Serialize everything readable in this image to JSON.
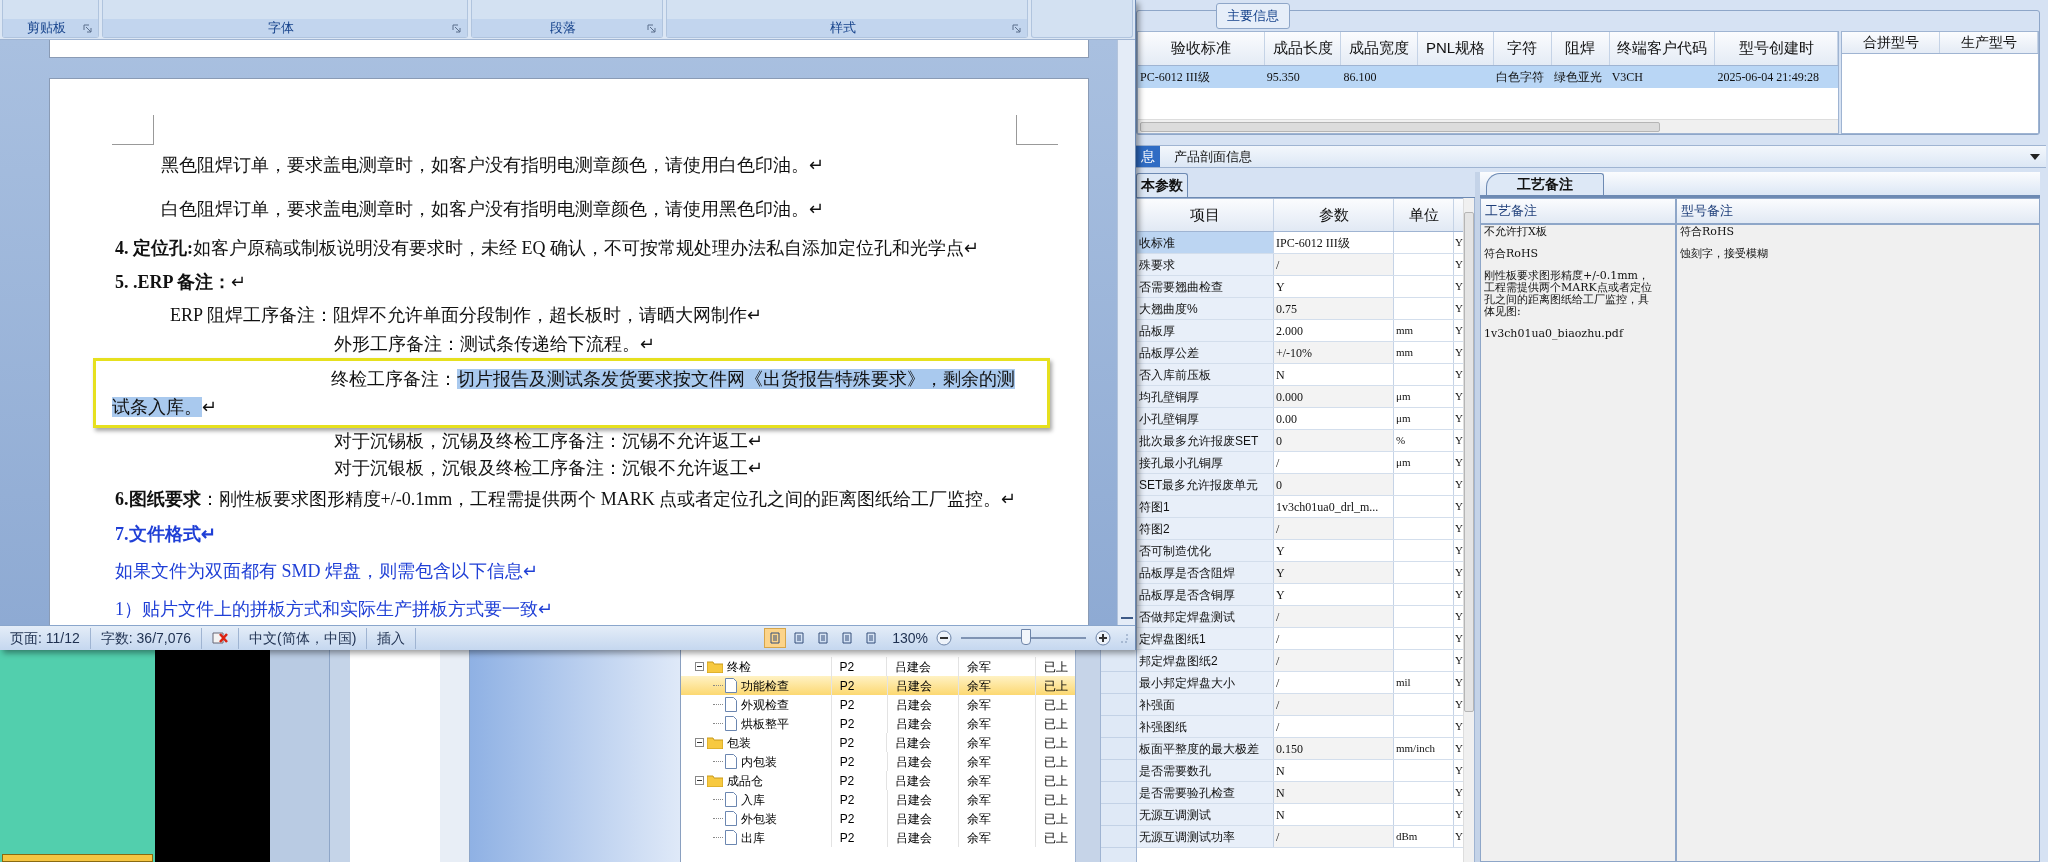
{
  "word": {
    "ribbon_groups": [
      "剪贴板",
      "字体",
      "段落",
      "样式"
    ],
    "paragraphs": [
      {
        "kind": "body",
        "framed": false,
        "text": "黑色阻焊订单，要求盖电测章时，如客户没有指明电测章颜色，请使用白色印油。↵"
      },
      {
        "kind": "body",
        "framed": false,
        "text": "白色阻焊订单，要求盖电测章时，如客户没有指明电测章颜色，请使用黑色印油。↵"
      },
      {
        "kind": "numbered",
        "framed": false,
        "text": "**4.  定位孔:**如客户原稿或制板说明没有要求时，未经 EQ 确认，不可按常规处理办法私自添加定位孔和光学点↵"
      },
      {
        "kind": "numbered",
        "framed": false,
        "text": "**5. .ERP 备注：**↵"
      },
      {
        "kind": "erp",
        "framed": false,
        "text": "ERP 阻焊工序备注：阻焊不允许单面分段制作，超长板时，请晒大网制作↵"
      },
      {
        "kind": "note",
        "framed": false,
        "text": "外形工序备注：测试条传递给下流程。↵"
      },
      {
        "kind": "note_wrap",
        "framed": true,
        "segments": [
          {
            "text": "终检工序备注：",
            "highlighted": false
          },
          {
            "text": "切片报告及测试条发货要求按文件网《出货报告特殊要求》，剩余的测试条入库。",
            "highlighted": true
          },
          {
            "text": "↵",
            "highlighted": false
          }
        ]
      },
      {
        "kind": "note",
        "framed": false,
        "text": "对于沉锡板，沉锡及终检工序备注：沉锡不允许返工↵"
      },
      {
        "kind": "note",
        "framed": false,
        "text": "对于沉银板，沉银及终检工序备注：沉银不允许返工↵"
      },
      {
        "kind": "numbered",
        "framed": false,
        "text": "**6.图纸要求**：刚性板要求图形精度+/-0.1mm，工程需提供两个 MARK 点或者定位孔之间的距离图纸给工厂监控。↵"
      },
      {
        "kind": "blue_heading",
        "framed": false,
        "text": "7.文件格式↵"
      },
      {
        "kind": "blue",
        "framed": false,
        "text": "如果文件为双面都有 SMD 焊盘，则需包含以下信息↵"
      },
      {
        "kind": "blue",
        "framed": false,
        "text": "1）贴片文件上的拼板方式和实际生产拼板方式要一致↵"
      }
    ],
    "status": {
      "page": "页面: 11/12",
      "words": "字数: 36/7,076",
      "language": "中文(简体，中国)",
      "mode": "插入",
      "zoom": "130%",
      "zoom_slider": {
        "level": 0.52
      },
      "view_buttons": [
        {
          "selected": true
        },
        {
          "selected": false
        },
        {
          "selected": false
        },
        {
          "selected": false
        },
        {
          "selected": false
        }
      ]
    }
  },
  "tree": {
    "items": [
      {
        "kind": "folder",
        "label": "终检",
        "expanded": true,
        "selected": false,
        "cells": [
          "P2",
          "吕建会",
          "余军",
          "已上"
        ],
        "children": [
          {
            "kind": "file",
            "label": "功能检查",
            "selected": true,
            "cells": [
              "P2",
              "吕建会",
              "余军",
              "已上"
            ]
          },
          {
            "kind": "file",
            "label": "外观检查",
            "selected": false,
            "cells": [
              "P2",
              "吕建会",
              "余军",
              "已上"
            ]
          },
          {
            "kind": "file",
            "label": "烘板整平",
            "selected": false,
            "cells": [
              "P2",
              "吕建会",
              "余军",
              "已上"
            ]
          }
        ]
      },
      {
        "kind": "folder",
        "label": "包装",
        "expanded": true,
        "selected": false,
        "cells": [
          "P2",
          "吕建会",
          "余军",
          "已上"
        ],
        "children": [
          {
            "kind": "file",
            "label": "内包装",
            "selected": false,
            "cells": [
              "P2",
              "吕建会",
              "余军",
              "已上"
            ]
          }
        ]
      },
      {
        "kind": "folder",
        "label": "成品仓",
        "expanded": true,
        "selected": false,
        "cells": [
          "P2",
          "吕建会",
          "余军",
          "已上"
        ],
        "children": [
          {
            "kind": "file",
            "label": "入库",
            "selected": false,
            "cells": [
              "P2",
              "吕建会",
              "余军",
              "已上"
            ]
          },
          {
            "kind": "file",
            "label": "外包装",
            "selected": false,
            "cells": [
              "P2",
              "吕建会",
              "余军",
              "已上"
            ]
          },
          {
            "kind": "file",
            "label": "出库",
            "selected": false,
            "cells": [
              "P2",
              "吕建会",
              "余军",
              "已上"
            ]
          }
        ]
      }
    ]
  },
  "main_info": {
    "legend": "主要信息",
    "columns": [
      "验收标准",
      "成品长度",
      "成品宽度",
      "PNL规格",
      "字符",
      "阻焊",
      "终端客户代码",
      "型号创建时"
    ],
    "rows": [
      {
        "selected": true,
        "cells": [
          "PC-6012 III级",
          "95.350",
          "86.100",
          null,
          "白色字符",
          "绿色亚光",
          "V3CH",
          "2025-06-04 21:49:28"
        ]
      }
    ],
    "side_columns": [
      "合拼型号",
      "生产型号"
    ]
  },
  "section_bar": {
    "tab": "息",
    "title": "产品剖面信息"
  },
  "params": {
    "tab": "本参数",
    "columns": [
      "项目",
      "参数",
      "单位"
    ],
    "rows": [
      {
        "item": "收标准",
        "value": "IPC-6012 III级",
        "flag": "Y",
        "selected": true
      },
      {
        "item": "殊要求",
        "value": "/",
        "flag": "Y",
        "selected": false
      },
      {
        "item": "否需要翘曲检查",
        "value": "Y",
        "flag": "Y",
        "selected": false
      },
      {
        "item": "大翘曲度%",
        "value": "0.75",
        "flag": "Y",
        "selected": false
      },
      {
        "item": "品板厚",
        "value": "2.000",
        "unit": "mm",
        "flag": "Y",
        "selected": false
      },
      {
        "item": "品板厚公差",
        "value": "+/-10%",
        "unit": "mm",
        "flag": "Y",
        "selected": false
      },
      {
        "item": "否入库前压板",
        "value": "N",
        "flag": "Y",
        "selected": false
      },
      {
        "item": "均孔壁铜厚",
        "value": "0.000",
        "unit": "μm",
        "flag": "Y",
        "selected": false
      },
      {
        "item": "小孔壁铜厚",
        "value": "0.00",
        "unit": "μm",
        "flag": "Y",
        "selected": false
      },
      {
        "item": "批次最多允许报废SET",
        "value": "0",
        "unit": "%",
        "flag": "Y",
        "selected": false
      },
      {
        "item": "接孔最小孔铜厚",
        "value": "/",
        "unit": "μm",
        "flag": "Y",
        "selected": false
      },
      {
        "item": "SET最多允许报废单元",
        "value": "0",
        "flag": "Y",
        "selected": false
      },
      {
        "item": "符图1",
        "value": "1v3ch01ua0_drl_m...",
        "flag": "Y",
        "selected": false
      },
      {
        "item": "符图2",
        "value": "/",
        "flag": "Y",
        "selected": false
      },
      {
        "item": "否可制造优化",
        "value": "Y",
        "flag": "Y",
        "selected": false
      },
      {
        "item": "品板厚是否含阻焊",
        "value": "Y",
        "flag": "Y",
        "selected": false
      },
      {
        "item": "品板厚是否含铜厚",
        "value": "Y",
        "flag": "Y",
        "selected": false
      },
      {
        "item": "否做邦定焊盘测试",
        "value": "/",
        "flag": "Y",
        "selected": false
      },
      {
        "item": "定焊盘图纸1",
        "value": "/",
        "flag": "Y",
        "selected": false
      },
      {
        "item": "邦定焊盘图纸2",
        "value": "/",
        "flag": "Y",
        "selected": false
      },
      {
        "item": "最小邦定焊盘大小",
        "value": "/",
        "unit": "mil",
        "flag": "Y",
        "selected": false
      },
      {
        "item": "补强面",
        "value": "/",
        "flag": "Y",
        "selected": false
      },
      {
        "item": "补强图纸",
        "value": "/",
        "flag": "Y",
        "selected": false
      },
      {
        "item": "板面平整度的最大极差",
        "value": "0.150",
        "unit": "mm/inch",
        "flag": "Y",
        "selected": false
      },
      {
        "item": "是否需要数孔",
        "value": "N",
        "flag": "Y",
        "selected": false
      },
      {
        "item": "是否需要验孔检查",
        "value": "N",
        "flag": "Y",
        "selected": false
      },
      {
        "item": "无源互调测试",
        "value": "N",
        "flag": "Y",
        "selected": false
      },
      {
        "item": "无源互调测试功率",
        "value": "/",
        "unit": "dBm",
        "flag": "Y",
        "selected": false
      }
    ]
  },
  "notes": {
    "tab": "工艺备注",
    "columns": [
      "工艺备注",
      "型号备注"
    ],
    "left": [
      "不允许打X板",
      "符合RoHS",
      "刚性板要求图形精度+/-0.1mm，工程需提供两个MARK点或者定位孔之间的距离图纸给工厂监控，具体见图:",
      "1v3ch01ua0_biaozhu.pdf"
    ],
    "right": [
      "符合RoHS",
      "蚀刻字，接受模糊"
    ]
  }
}
